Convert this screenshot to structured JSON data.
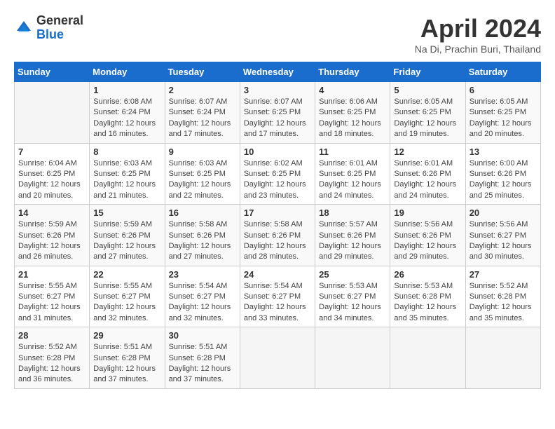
{
  "header": {
    "logo_general": "General",
    "logo_blue": "Blue",
    "month_title": "April 2024",
    "location": "Na Di, Prachin Buri, Thailand"
  },
  "calendar": {
    "weekdays": [
      "Sunday",
      "Monday",
      "Tuesday",
      "Wednesday",
      "Thursday",
      "Friday",
      "Saturday"
    ],
    "rows": [
      [
        {
          "day": "",
          "info": ""
        },
        {
          "day": "1",
          "info": "Sunrise: 6:08 AM\nSunset: 6:24 PM\nDaylight: 12 hours\nand 16 minutes."
        },
        {
          "day": "2",
          "info": "Sunrise: 6:07 AM\nSunset: 6:24 PM\nDaylight: 12 hours\nand 17 minutes."
        },
        {
          "day": "3",
          "info": "Sunrise: 6:07 AM\nSunset: 6:25 PM\nDaylight: 12 hours\nand 17 minutes."
        },
        {
          "day": "4",
          "info": "Sunrise: 6:06 AM\nSunset: 6:25 PM\nDaylight: 12 hours\nand 18 minutes."
        },
        {
          "day": "5",
          "info": "Sunrise: 6:05 AM\nSunset: 6:25 PM\nDaylight: 12 hours\nand 19 minutes."
        },
        {
          "day": "6",
          "info": "Sunrise: 6:05 AM\nSunset: 6:25 PM\nDaylight: 12 hours\nand 20 minutes."
        }
      ],
      [
        {
          "day": "7",
          "info": "Sunrise: 6:04 AM\nSunset: 6:25 PM\nDaylight: 12 hours\nand 20 minutes."
        },
        {
          "day": "8",
          "info": "Sunrise: 6:03 AM\nSunset: 6:25 PM\nDaylight: 12 hours\nand 21 minutes."
        },
        {
          "day": "9",
          "info": "Sunrise: 6:03 AM\nSunset: 6:25 PM\nDaylight: 12 hours\nand 22 minutes."
        },
        {
          "day": "10",
          "info": "Sunrise: 6:02 AM\nSunset: 6:25 PM\nDaylight: 12 hours\nand 23 minutes."
        },
        {
          "day": "11",
          "info": "Sunrise: 6:01 AM\nSunset: 6:25 PM\nDaylight: 12 hours\nand 24 minutes."
        },
        {
          "day": "12",
          "info": "Sunrise: 6:01 AM\nSunset: 6:26 PM\nDaylight: 12 hours\nand 24 minutes."
        },
        {
          "day": "13",
          "info": "Sunrise: 6:00 AM\nSunset: 6:26 PM\nDaylight: 12 hours\nand 25 minutes."
        }
      ],
      [
        {
          "day": "14",
          "info": "Sunrise: 5:59 AM\nSunset: 6:26 PM\nDaylight: 12 hours\nand 26 minutes."
        },
        {
          "day": "15",
          "info": "Sunrise: 5:59 AM\nSunset: 6:26 PM\nDaylight: 12 hours\nand 27 minutes."
        },
        {
          "day": "16",
          "info": "Sunrise: 5:58 AM\nSunset: 6:26 PM\nDaylight: 12 hours\nand 27 minutes."
        },
        {
          "day": "17",
          "info": "Sunrise: 5:58 AM\nSunset: 6:26 PM\nDaylight: 12 hours\nand 28 minutes."
        },
        {
          "day": "18",
          "info": "Sunrise: 5:57 AM\nSunset: 6:26 PM\nDaylight: 12 hours\nand 29 minutes."
        },
        {
          "day": "19",
          "info": "Sunrise: 5:56 AM\nSunset: 6:26 PM\nDaylight: 12 hours\nand 29 minutes."
        },
        {
          "day": "20",
          "info": "Sunrise: 5:56 AM\nSunset: 6:27 PM\nDaylight: 12 hours\nand 30 minutes."
        }
      ],
      [
        {
          "day": "21",
          "info": "Sunrise: 5:55 AM\nSunset: 6:27 PM\nDaylight: 12 hours\nand 31 minutes."
        },
        {
          "day": "22",
          "info": "Sunrise: 5:55 AM\nSunset: 6:27 PM\nDaylight: 12 hours\nand 32 minutes."
        },
        {
          "day": "23",
          "info": "Sunrise: 5:54 AM\nSunset: 6:27 PM\nDaylight: 12 hours\nand 32 minutes."
        },
        {
          "day": "24",
          "info": "Sunrise: 5:54 AM\nSunset: 6:27 PM\nDaylight: 12 hours\nand 33 minutes."
        },
        {
          "day": "25",
          "info": "Sunrise: 5:53 AM\nSunset: 6:27 PM\nDaylight: 12 hours\nand 34 minutes."
        },
        {
          "day": "26",
          "info": "Sunrise: 5:53 AM\nSunset: 6:28 PM\nDaylight: 12 hours\nand 35 minutes."
        },
        {
          "day": "27",
          "info": "Sunrise: 5:52 AM\nSunset: 6:28 PM\nDaylight: 12 hours\nand 35 minutes."
        }
      ],
      [
        {
          "day": "28",
          "info": "Sunrise: 5:52 AM\nSunset: 6:28 PM\nDaylight: 12 hours\nand 36 minutes."
        },
        {
          "day": "29",
          "info": "Sunrise: 5:51 AM\nSunset: 6:28 PM\nDaylight: 12 hours\nand 37 minutes."
        },
        {
          "day": "30",
          "info": "Sunrise: 5:51 AM\nSunset: 6:28 PM\nDaylight: 12 hours\nand 37 minutes."
        },
        {
          "day": "",
          "info": ""
        },
        {
          "day": "",
          "info": ""
        },
        {
          "day": "",
          "info": ""
        },
        {
          "day": "",
          "info": ""
        }
      ]
    ]
  }
}
